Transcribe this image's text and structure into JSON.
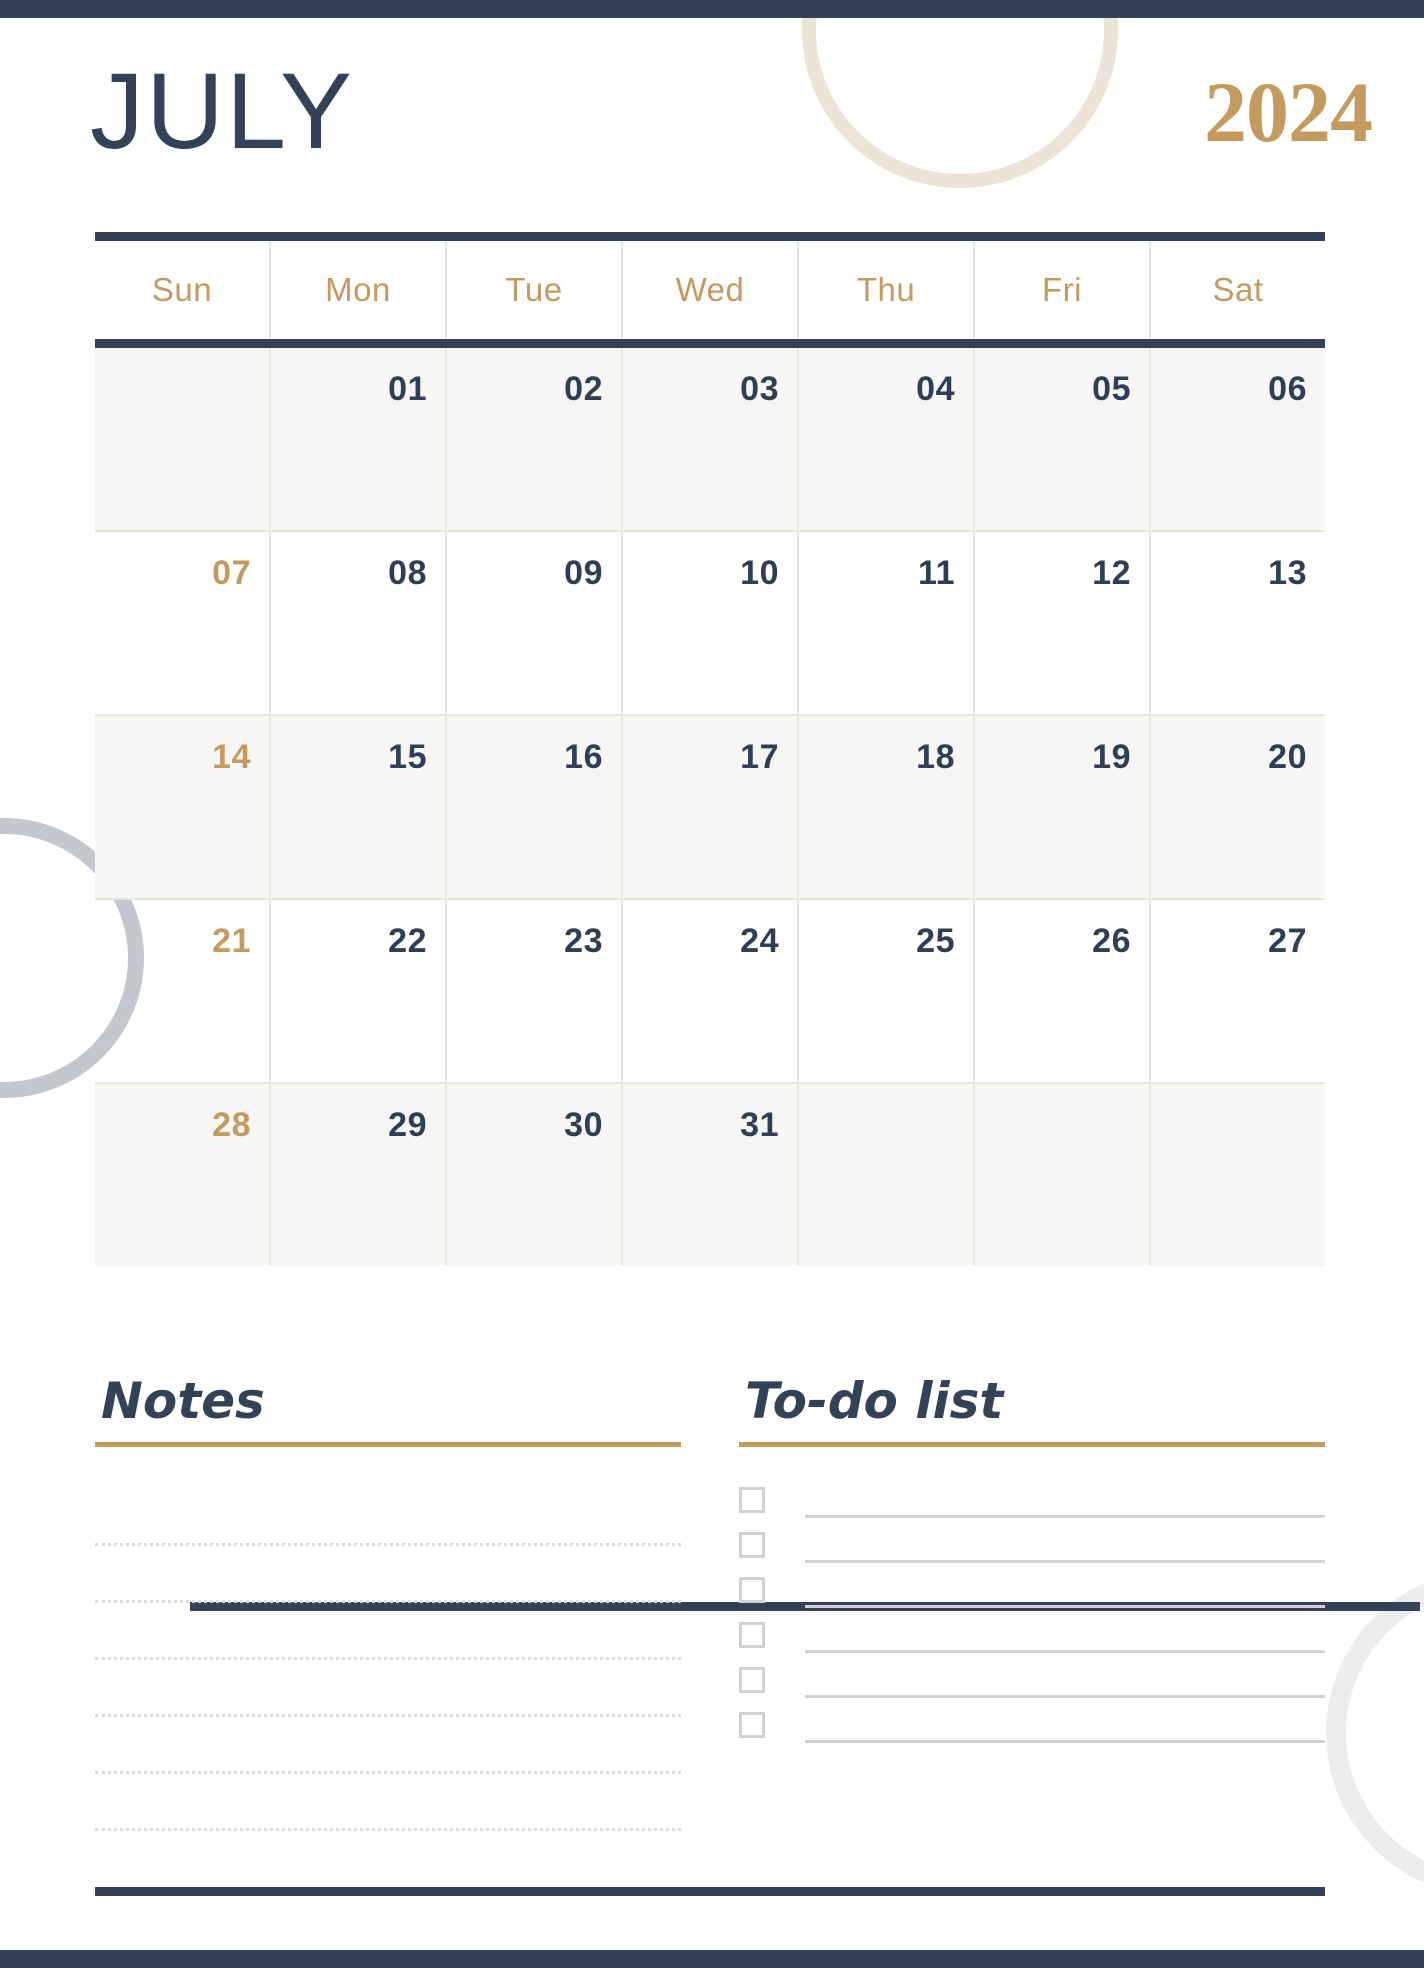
{
  "page": {
    "type": "monthly-calendar-planner",
    "colors": {
      "navy": "#344257",
      "gold": "#c49a5f",
      "grid_line": "#e2eadc",
      "shaded_row": "#f6f7f5",
      "cream_circle": "#ece4d6",
      "grey_circle": "#c3c8ce",
      "light_circle": "#ececec",
      "rule_grey": "#d2d2d2"
    }
  },
  "header": {
    "month": "JULY",
    "year": "2024"
  },
  "calendar": {
    "weekdays": [
      "Sun",
      "Mon",
      "Tue",
      "Wed",
      "Thu",
      "Fri",
      "Sat"
    ],
    "weeks": [
      {
        "shaded": true,
        "days": [
          "",
          "01",
          "02",
          "03",
          "04",
          "05",
          "06"
        ]
      },
      {
        "shaded": false,
        "days": [
          "07",
          "08",
          "09",
          "10",
          "11",
          "12",
          "13"
        ]
      },
      {
        "shaded": true,
        "days": [
          "14",
          "15",
          "16",
          "17",
          "18",
          "19",
          "20"
        ]
      },
      {
        "shaded": false,
        "days": [
          "21",
          "22",
          "23",
          "24",
          "25",
          "26",
          "27"
        ]
      },
      {
        "shaded": true,
        "days": [
          "28",
          "29",
          "30",
          "31",
          "",
          "",
          ""
        ]
      }
    ]
  },
  "notes": {
    "title": "Notes",
    "line_count": 6
  },
  "todo": {
    "title": "To-do list",
    "items": [
      "",
      "",
      "",
      "",
      "",
      ""
    ]
  }
}
